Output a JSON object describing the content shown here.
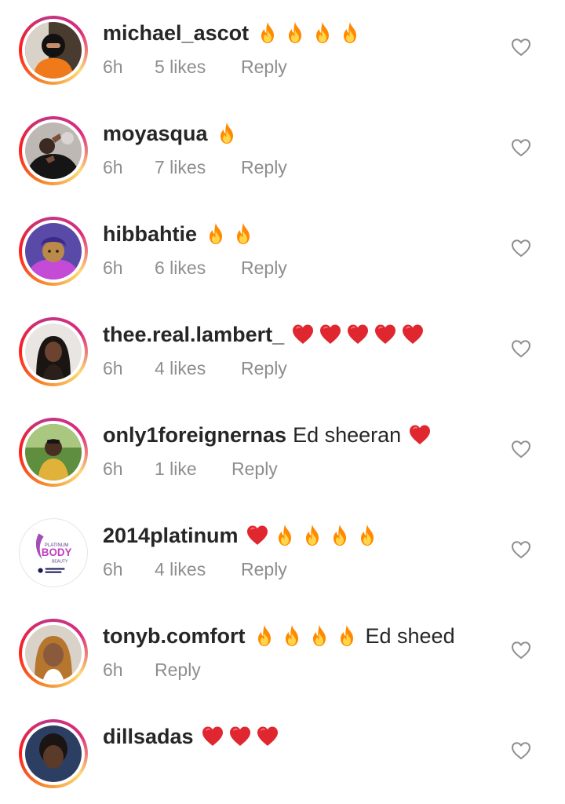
{
  "comments": [
    {
      "username": "michael_ascot",
      "text": "",
      "emojis": [
        "fire",
        "fire",
        "fire",
        "fire"
      ],
      "emojis_after": [],
      "time": "6h",
      "likes": "5 likes",
      "reply": "Reply",
      "story_ring": true
    },
    {
      "username": "moyasqua",
      "text": "",
      "emojis": [
        "fire"
      ],
      "emojis_after": [],
      "time": "6h",
      "likes": "7 likes",
      "reply": "Reply",
      "story_ring": true
    },
    {
      "username": "hibbahtie",
      "text": "",
      "emojis": [
        "fire",
        "fire"
      ],
      "emojis_after": [],
      "time": "6h",
      "likes": "6 likes",
      "reply": "Reply",
      "story_ring": true
    },
    {
      "username": "thee.real.lambert_",
      "text": "",
      "emojis": [
        "red-heart",
        "red-heart",
        "red-heart",
        "red-heart",
        "red-heart"
      ],
      "emojis_after": [],
      "time": "6h",
      "likes": "4 likes",
      "reply": "Reply",
      "story_ring": true
    },
    {
      "username": "only1foreignernas",
      "text": "Ed sheeran",
      "emojis": [],
      "emojis_after": [
        "red-heart"
      ],
      "time": "6h",
      "likes": "1 like",
      "reply": "Reply",
      "story_ring": true
    },
    {
      "username": "2014platinum",
      "text": "",
      "emojis": [
        "red-heart",
        "fire",
        "fire",
        "fire",
        "fire"
      ],
      "emojis_after": [],
      "time": "6h",
      "likes": "4 likes",
      "reply": "Reply",
      "story_ring": false
    },
    {
      "username": "tonyb.comfort",
      "text": "Ed sheed",
      "emojis": [
        "fire",
        "fire",
        "fire",
        "fire"
      ],
      "emojis_after": [],
      "time": "6h",
      "likes": "",
      "reply": "Reply",
      "story_ring": true
    },
    {
      "username": "dillsadas",
      "text": "",
      "emojis": [
        "red-heart",
        "red-heart",
        "red-heart"
      ],
      "emojis_after": [],
      "time": "",
      "likes": "",
      "reply": "",
      "story_ring": true
    }
  ],
  "avatar_logo": {
    "line1": "PLATINUM",
    "line2": "BODY",
    "line3": "BEAUTY"
  },
  "colors": {
    "username": "#262626",
    "meta": "#8e8e8e",
    "heart_outline": "#8e8e8e",
    "emoji_heart": "#e0262e",
    "emoji_fire": "#ff8a00"
  },
  "icons": {
    "like": "heart-outline-icon"
  }
}
